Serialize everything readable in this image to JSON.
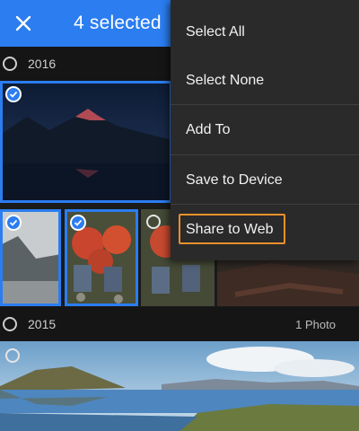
{
  "header": {
    "title": "4 selected",
    "close_icon": "close-icon"
  },
  "sections": [
    {
      "year": "2016",
      "count": ""
    },
    {
      "year": "2015",
      "count": "1 Photo"
    }
  ],
  "menu": {
    "items": [
      {
        "label": "Select All"
      },
      {
        "label": "Select None"
      },
      {
        "label": "Add To"
      },
      {
        "label": "Save to Device"
      },
      {
        "label": "Share to Web",
        "highlighted": true
      }
    ]
  },
  "colors": {
    "accent": "#2b7df0",
    "highlight": "#e8912b",
    "menu_bg": "#2a2a2a"
  }
}
